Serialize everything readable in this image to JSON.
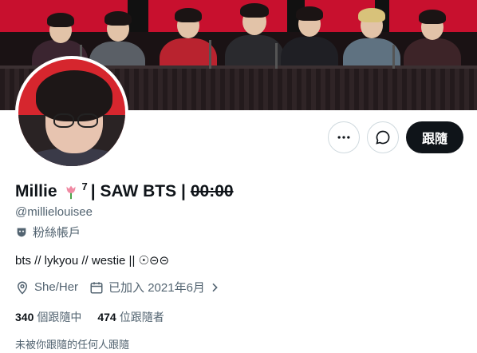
{
  "profile": {
    "display_name": "Millie",
    "name_superscript": "7",
    "name_mid": "| SAW BTS |",
    "name_strike": "00:00",
    "handle": "@millielouisee",
    "badge_label": "粉絲帳戶",
    "bio": "bts // lykyou // westie || ☉⊝⊝",
    "location": "She/Her",
    "joined": "已加入 2021年6月",
    "following_count": "340",
    "following_label": "個跟隨中",
    "followers_count": "474",
    "followers_label": "位跟隨者",
    "followed_by_note": "未被你跟隨的任何人跟隨"
  },
  "actions": {
    "follow_label": "跟隨",
    "more_icon": "more-icon",
    "message_icon": "message-icon"
  },
  "colors": {
    "follow_bg": "#0f1419",
    "secondary_text": "#536471",
    "border": "#cfd9de",
    "banner_red": "#c8102e",
    "avatar_bg": "#d6262e"
  }
}
